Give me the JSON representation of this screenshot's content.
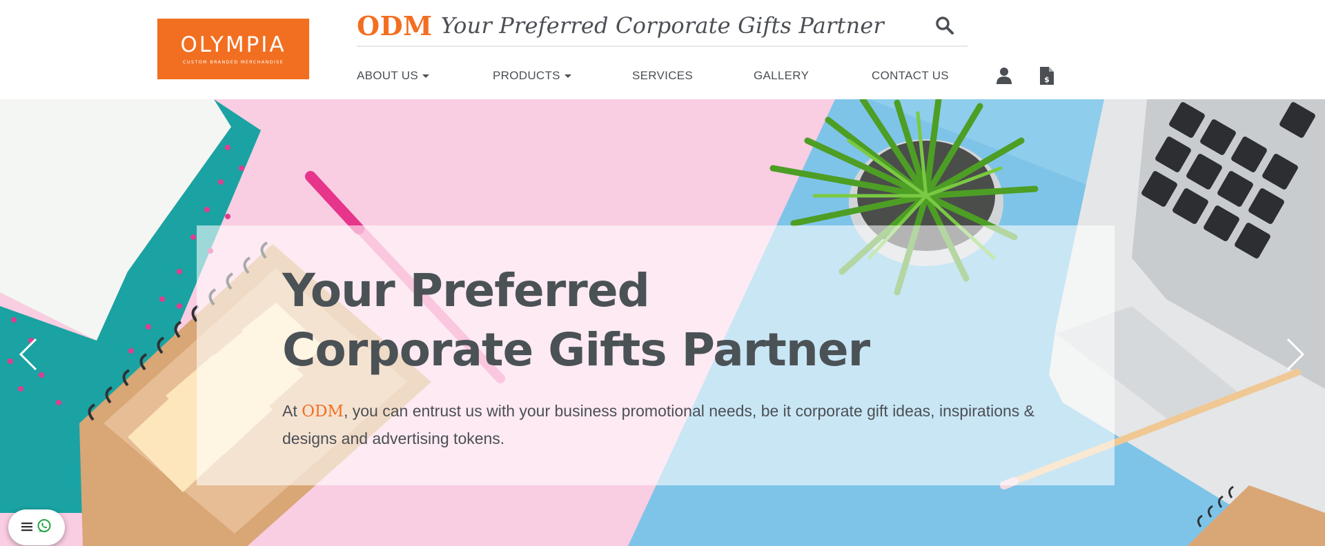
{
  "logo": {
    "word": "OLYMPIA",
    "tagline": "CUSTOM BRANDED MERCHANDISE"
  },
  "header": {
    "brand": "ODM",
    "tagline": "Your Preferred Corporate Gifts Partner",
    "search_icon": "search-icon"
  },
  "nav": {
    "items": [
      {
        "label": "ABOUT US",
        "dropdown": true
      },
      {
        "label": "PRODUCTS",
        "dropdown": true
      },
      {
        "label": "SERVICES",
        "dropdown": false
      },
      {
        "label": "GALLERY",
        "dropdown": false
      },
      {
        "label": "CONTACT US",
        "dropdown": false
      }
    ],
    "icons": [
      "user-icon",
      "invoice-dollar-icon"
    ]
  },
  "hero": {
    "title_line1": "Your Preferred",
    "title_line2": "Corporate Gifts Partner",
    "text_prefix": "At ",
    "text_brand": "ODM",
    "text_suffix": ", you can entrust us with your business promotional needs, be it corporate gift ideas, inspirations & designs and advertising tokens."
  },
  "floating_widget": {
    "icons": [
      "menu-icon",
      "whatsapp-icon"
    ]
  },
  "colors": {
    "accent": "#f26f21",
    "text": "#4b4f54",
    "hero_pink": "#f9cde2",
    "hero_blue": "#7ec4e8"
  }
}
